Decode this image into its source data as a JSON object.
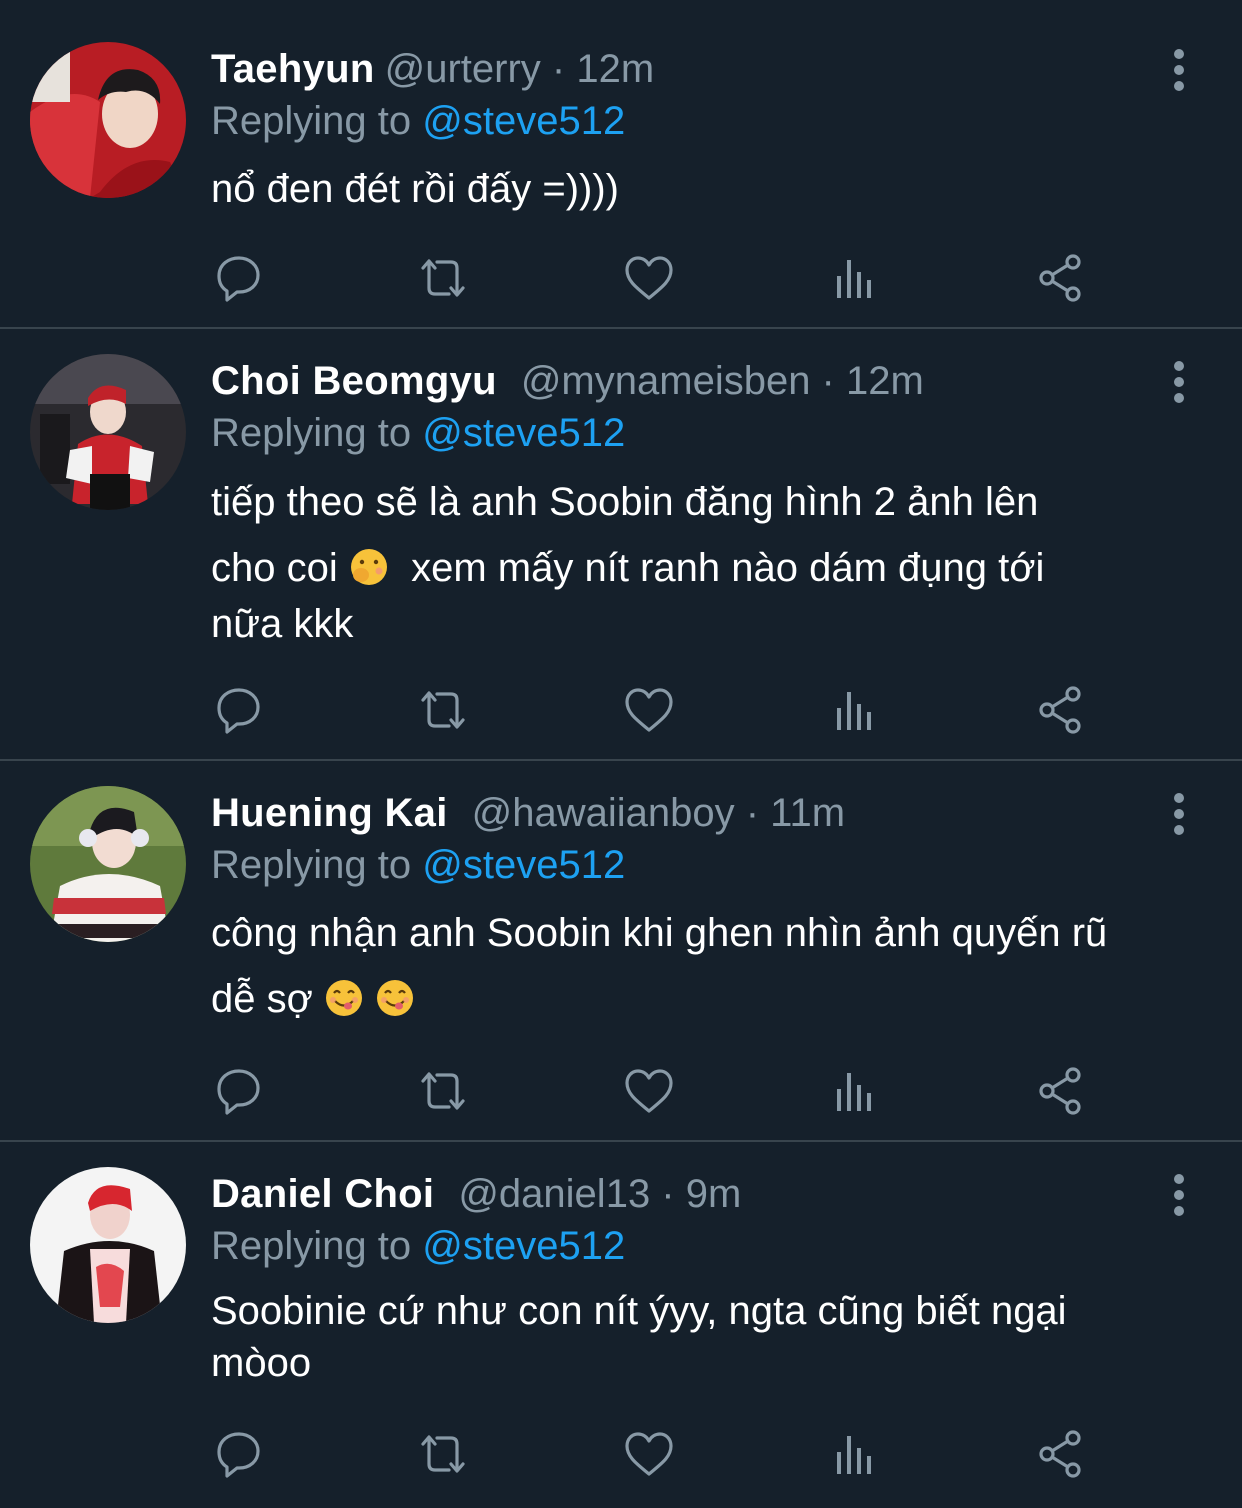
{
  "replying_prefix": "Replying to",
  "tweets": [
    {
      "name": "Taehyun",
      "handle_time": "@urterry · 12m",
      "mention": "@steve512",
      "lines": [
        "nổ đen đét rồi đấy =))))"
      ]
    },
    {
      "name": "Choi Beomgyu",
      "handle_time": "@mynameisben · 12m",
      "mention": "@steve512",
      "lines": [
        "tiếp theo sẽ là anh Soobin đăng hình 2 ảnh lên",
        "cho coi",
        "xem mấy nít ranh nào dám đụng tới",
        "nữa kkk"
      ]
    },
    {
      "name": "Huening Kai",
      "handle_time": "@hawaiianboy · 11m",
      "mention": "@steve512",
      "lines": [
        "công nhận anh Soobin khi ghen nhìn ảnh quyến rũ",
        "dễ sợ"
      ]
    },
    {
      "name": "Daniel Choi",
      "handle_time": "@daniel13 · 9m",
      "mention": "@steve512",
      "lines": [
        "Soobinie cứ như con nít ýyy, ngta cũng biết ngại",
        "mòoo"
      ]
    }
  ],
  "icons": [
    "reply-icon",
    "retweet-icon",
    "like-icon",
    "analytics-icon",
    "share-icon",
    "more-options-icon"
  ],
  "colors": {
    "background": "#15202b",
    "divider": "#38444d",
    "secondary_text": "#8899a6",
    "link": "#1da1f2",
    "primary_text": "#ffffff"
  }
}
